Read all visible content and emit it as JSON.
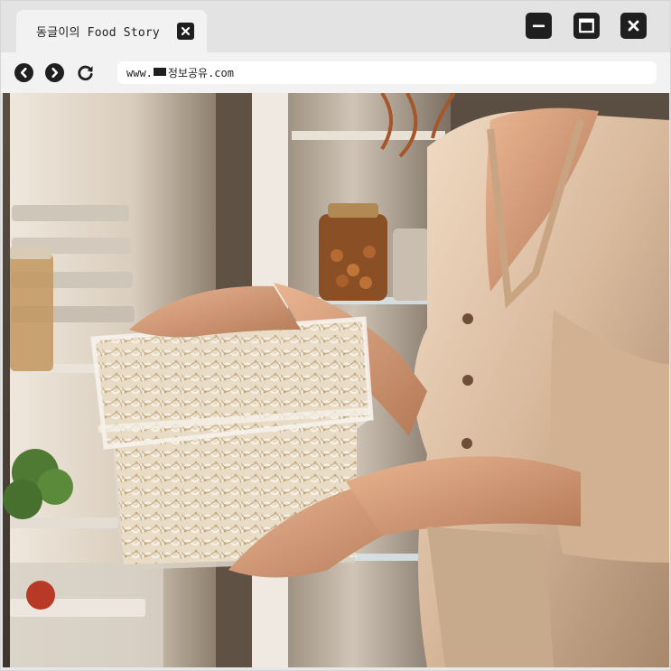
{
  "tab": {
    "title": "동글이의 Food Story"
  },
  "address_bar": {
    "url_prefix": "www.",
    "url_domain": "정보공유.com"
  },
  "icons": {
    "tab_close": "close-icon",
    "minimize": "minimize-icon",
    "maximize": "maximize-icon",
    "close": "close-icon",
    "back": "chevron-left-icon",
    "forward": "chevron-right-icon",
    "reload": "reload-icon"
  },
  "colors": {
    "titlebar_bg": "#e3e3e3",
    "tab_bg": "#f2f2f2",
    "icon_dark": "#1f1f1f"
  },
  "photo": {
    "subject": "woman holding container of bean sprouts at open refrigerator"
  }
}
